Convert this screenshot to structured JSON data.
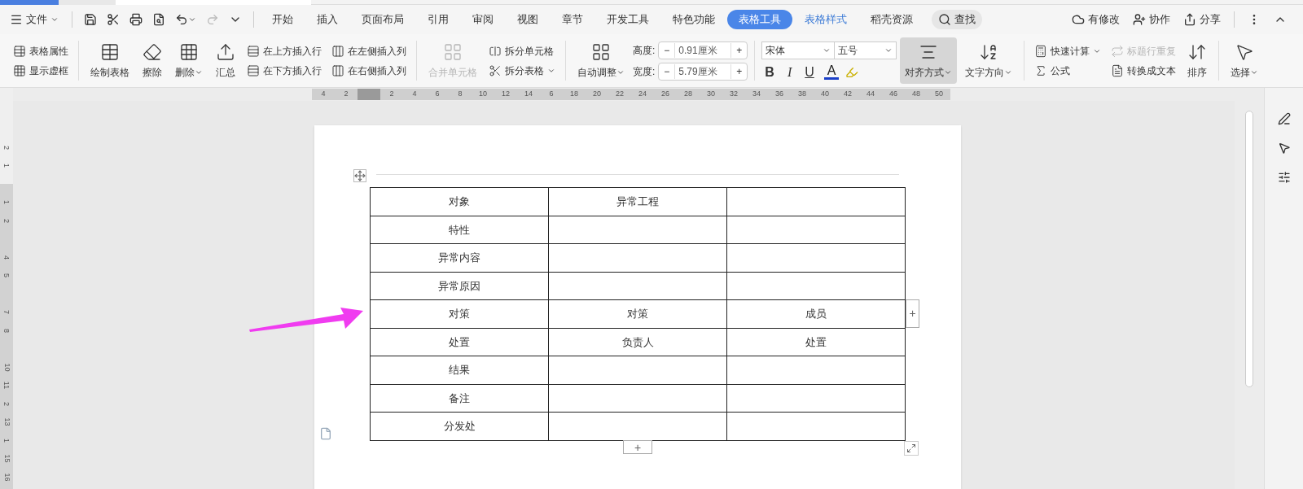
{
  "menu_bar": {
    "file_menu": "文件",
    "tabs": [
      {
        "label": "开始",
        "selected": false,
        "contextual": false
      },
      {
        "label": "插入",
        "selected": false,
        "contextual": false
      },
      {
        "label": "页面布局",
        "selected": false,
        "contextual": false
      },
      {
        "label": "引用",
        "selected": false,
        "contextual": false
      },
      {
        "label": "审阅",
        "selected": false,
        "contextual": false
      },
      {
        "label": "视图",
        "selected": false,
        "contextual": false
      },
      {
        "label": "章节",
        "selected": false,
        "contextual": false
      },
      {
        "label": "开发工具",
        "selected": false,
        "contextual": false
      },
      {
        "label": "特色功能",
        "selected": false,
        "contextual": false
      },
      {
        "label": "表格工具",
        "selected": true,
        "contextual": true
      },
      {
        "label": "表格样式",
        "selected": false,
        "contextual": true
      },
      {
        "label": "稻壳资源",
        "selected": false,
        "contextual": false
      }
    ],
    "search": "查找",
    "actions": [
      "有修改",
      "协作",
      "分享"
    ]
  },
  "ribbon": [
    [
      {
        "kind": "stack",
        "items": [
          {
            "label": "表格属性",
            "dropdown": false,
            "disabled": false
          },
          {
            "label": "显示虚框",
            "dropdown": false,
            "disabled": false
          }
        ]
      }
    ],
    [
      {
        "kind": "large",
        "label": "绘制表格",
        "dropdown": false,
        "disabled": false,
        "selected": false
      },
      {
        "kind": "large",
        "label": "擦除",
        "dropdown": false,
        "disabled": false,
        "selected": false
      },
      {
        "kind": "large",
        "label": "删除",
        "dropdown": true,
        "disabled": false,
        "selected": false
      },
      {
        "kind": "large",
        "label": "汇总",
        "dropdown": false,
        "disabled": false,
        "selected": false
      },
      {
        "kind": "stack",
        "items": [
          {
            "label": "在上方插入行",
            "dropdown": false,
            "disabled": false
          },
          {
            "label": "在下方插入行",
            "dropdown": false,
            "disabled": false
          }
        ]
      },
      {
        "kind": "stack",
        "items": [
          {
            "label": "在左侧插入列",
            "dropdown": false,
            "disabled": false
          },
          {
            "label": "在右侧插入列",
            "dropdown": false,
            "disabled": false
          }
        ]
      }
    ],
    [
      {
        "kind": "large",
        "label": "合并单元格",
        "dropdown": false,
        "disabled": true,
        "selected": false
      },
      {
        "kind": "stack",
        "items": [
          {
            "label": "拆分单元格",
            "dropdown": false,
            "disabled": false
          },
          {
            "label": "拆分表格",
            "dropdown": true,
            "disabled": false
          }
        ]
      }
    ],
    [
      {
        "kind": "large",
        "label": "自动调整",
        "dropdown": true,
        "disabled": false,
        "selected": false
      },
      {
        "kind": "fields",
        "items": [
          {
            "label": "高度:",
            "value": "0.91厘米",
            "minus": "−",
            "plus": "+"
          },
          {
            "label": "宽度:",
            "value": "5.79厘米",
            "minus": "−",
            "plus": "+"
          }
        ]
      }
    ],
    [
      {
        "kind": "font",
        "font": "宋体",
        "size": "五号",
        "buttons": [
          "B",
          "I",
          "U",
          "A"
        ]
      },
      {
        "kind": "large",
        "label": "对齐方式",
        "dropdown": true,
        "disabled": false,
        "selected": true
      },
      {
        "kind": "large",
        "label": "文字方向",
        "dropdown": true,
        "disabled": false,
        "selected": false
      }
    ],
    [
      {
        "kind": "stack",
        "items": [
          {
            "label": "快速计算",
            "dropdown": true,
            "disabled": false
          },
          {
            "label": "公式",
            "dropdown": false,
            "disabled": false
          }
        ]
      },
      {
        "kind": "stack",
        "items": [
          {
            "label": "标题行重复",
            "dropdown": false,
            "disabled": true
          },
          {
            "label": "转换成文本",
            "dropdown": false,
            "disabled": false
          }
        ]
      },
      {
        "kind": "large",
        "label": "排序",
        "dropdown": false,
        "disabled": false,
        "selected": false
      }
    ],
    [
      {
        "kind": "large",
        "label": "选择",
        "dropdown": true,
        "disabled": false,
        "selected": false
      }
    ]
  ],
  "ruler_h": [
    "4",
    "2",
    "2",
    "4",
    "6",
    "8",
    "10",
    "12",
    "14",
    "6",
    "18",
    "20",
    "22",
    "24",
    "26",
    "28",
    "30",
    "32",
    "34",
    "36",
    "38",
    "40",
    "42",
    "44",
    "46",
    "48",
    "50"
  ],
  "ruler_v": [
    "2",
    "1",
    "1",
    "2",
    "4",
    "5",
    "7",
    "8",
    "10",
    "11",
    "2",
    "13",
    "1",
    "15",
    "16"
  ],
  "table": {
    "rows": [
      [
        "对象",
        "异常工程",
        null
      ],
      [
        "特性",
        null,
        null
      ],
      [
        "异常内容",
        null,
        null
      ],
      [
        "异常原因",
        null,
        null
      ],
      [
        "对策",
        "对策",
        "成员"
      ],
      [
        "处置",
        "负责人",
        "处置"
      ],
      [
        "结果",
        null,
        null
      ],
      [
        "备注",
        null,
        null
      ],
      [
        "分发处",
        null,
        null
      ]
    ],
    "add_column": "+",
    "add_row": "+"
  }
}
